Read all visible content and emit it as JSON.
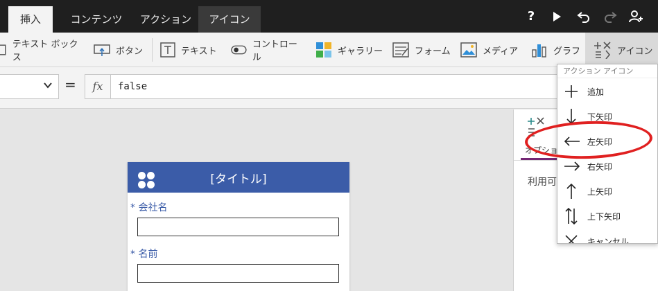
{
  "tabs": [
    {
      "label": "挿入",
      "state": "active"
    },
    {
      "label": "コンテンツ",
      "state": "normal"
    },
    {
      "label": "アクション",
      "state": "normal"
    },
    {
      "label": "アイコン",
      "state": "selected"
    }
  ],
  "top_icons": {
    "help": "?"
  },
  "ribbon": {
    "textbox_label": "テキスト ボックス",
    "button_label": "ボタン",
    "text_label": "テキスト",
    "controls_label": "コントロール",
    "gallery_label": "ギャラリー",
    "form_label": "フォーム",
    "media_label": "メディア",
    "chart_label": "グラフ",
    "icons_label": "アイコン"
  },
  "formula_bar": {
    "equals": "=",
    "fx": "fx",
    "value": "false"
  },
  "form": {
    "title": "[タイトル]",
    "fields": [
      {
        "label": "* 会社名"
      },
      {
        "label": "* 名前"
      }
    ]
  },
  "right_panel": {
    "tab_label": "オプショ",
    "available_text": "利用可"
  },
  "icons_menu": {
    "header": "アクション アイコン",
    "items": [
      {
        "label": "追加",
        "icon": "plus-icon"
      },
      {
        "label": "下矢印",
        "icon": "arrow-down-icon"
      },
      {
        "label": "左矢印",
        "icon": "arrow-left-icon"
      },
      {
        "label": "右矢印",
        "icon": "arrow-right-icon"
      },
      {
        "label": "上矢印",
        "icon": "arrow-up-icon"
      },
      {
        "label": "上下矢印",
        "icon": "arrow-up-down-icon"
      },
      {
        "label": "キャンセル",
        "icon": "cancel-icon"
      }
    ]
  },
  "colors": {
    "form_header": "#3b5ca8",
    "highlight_ring": "#e02020",
    "topbar": "#1f1f1f"
  }
}
